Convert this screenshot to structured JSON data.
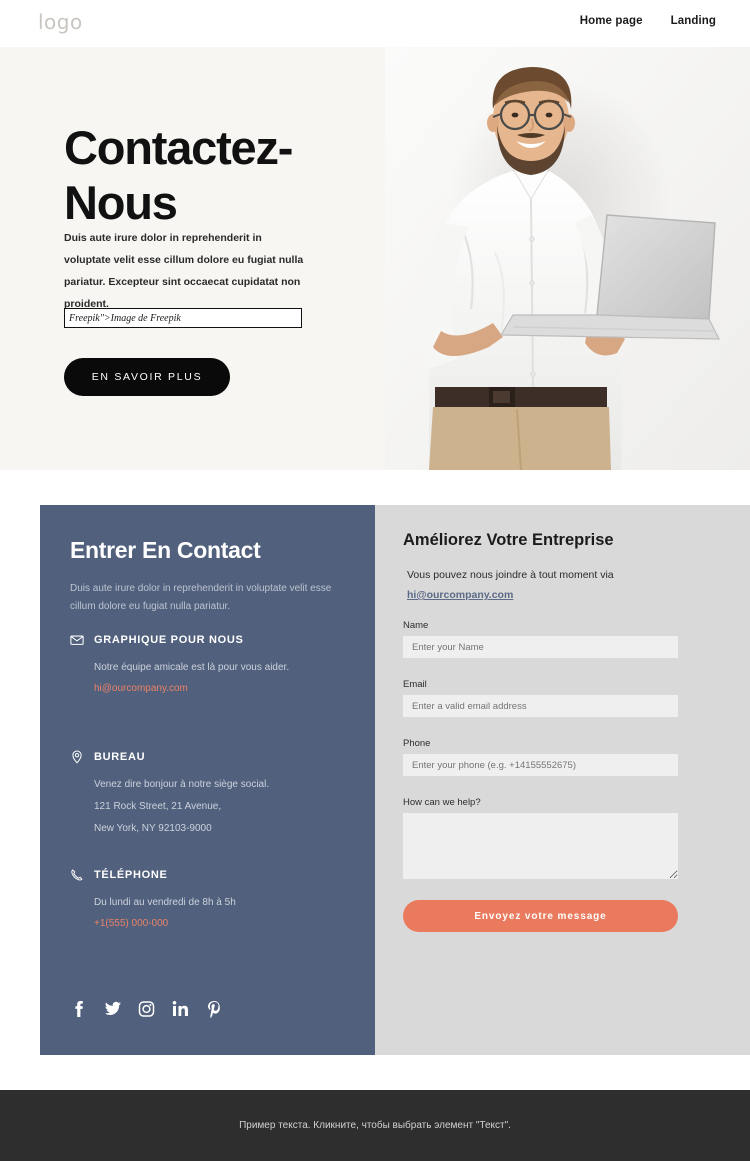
{
  "header": {
    "logo": "logo",
    "nav": [
      {
        "label": "Home page"
      },
      {
        "label": "Landing"
      }
    ]
  },
  "hero": {
    "title": "Contactez-Nous",
    "description": "Duis aute irure dolor in reprehenderit in voluptate velit esse cillum dolore eu fugiat nulla pariatur. Excepteur sint occaecat cupidatat non proident.",
    "input_value": "Freepik\">Image de Freepik",
    "button_label": "EN SAVOIR PLUS",
    "background_color": "#f7f6f3",
    "image_alt": "smiling-bearded-man-with-glasses-holding-laptop"
  },
  "contact_panel": {
    "background_color": "#51607c",
    "accent_color": "#e8836a",
    "title": "Entrer En Contact",
    "description": "Duis aute irure dolor in reprehenderit in voluptate velit esse cillum dolore eu fugiat nulla pariatur.",
    "blocks": [
      {
        "icon": "envelope-icon",
        "heading": "GRAPHIQUE POUR NOUS",
        "body": "Notre équipe amicale est là pour vous aider.",
        "link": "hi@ourcompany.com"
      },
      {
        "icon": "location-pin-icon",
        "heading": "BUREAU",
        "body": "Venez dire bonjour à notre siège social.",
        "line2": "121 Rock Street, 21 Avenue,",
        "line3": "New York, NY 92103-9000"
      },
      {
        "icon": "phone-icon",
        "heading": "TÉLÉPHONE",
        "body": "Du lundi au vendredi de 8h à 5h",
        "link": "+1(555) 000-000"
      }
    ],
    "socials": [
      {
        "name": "facebook-icon"
      },
      {
        "name": "twitter-icon"
      },
      {
        "name": "instagram-icon"
      },
      {
        "name": "linkedin-icon"
      },
      {
        "name": "pinterest-icon"
      }
    ]
  },
  "form_panel": {
    "background_color": "#d9d9d9",
    "title": "Améliorez Votre Entreprise",
    "subtitle": "Vous pouvez nous joindre à tout moment via",
    "email_link": "hi@ourcompany.com",
    "fields": [
      {
        "label": "Name",
        "placeholder": "Enter your Name",
        "value": ""
      },
      {
        "label": "Email",
        "placeholder": "Enter a valid email address",
        "value": ""
      },
      {
        "label": "Phone",
        "placeholder": "Enter your phone (e.g. +14155552675)",
        "value": ""
      }
    ],
    "textarea": {
      "label": "How can we help?",
      "placeholder": "",
      "value": ""
    },
    "submit_label": "Envoyez votre message",
    "submit_color": "#ea7a5d"
  },
  "footer": {
    "text": "Пример текста. Кликните, чтобы выбрать элемент \"Текст\".",
    "background_color": "#2e2e2e"
  }
}
